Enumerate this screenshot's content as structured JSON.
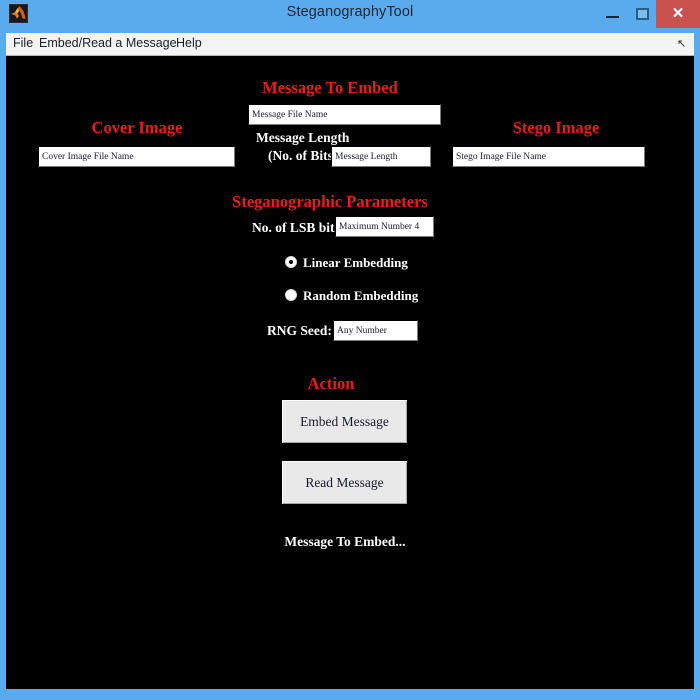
{
  "window": {
    "title": "SteganographyTool",
    "app_icon": "matlab-icon",
    "controls": {
      "minimize": "–",
      "maximize": "□",
      "close": "✕"
    },
    "frame_color": "#5aabee",
    "close_color": "#c9524f",
    "client_background": "#000000"
  },
  "menubar": {
    "items": [
      {
        "label": "File"
      },
      {
        "label": "Embed/Read a Message"
      },
      {
        "label": "Help"
      }
    ],
    "overflow_icon": "↖"
  },
  "theme": {
    "heading_color": "#f01a1a",
    "label_color": "#ffffff",
    "field_background": "#ffffff",
    "button_face": "#e9e9e9"
  },
  "panels": {
    "cover_image": {
      "heading": "Cover Image",
      "file_field": {
        "value": "",
        "placeholder": "Cover Image File Name"
      }
    },
    "message_to_embed": {
      "heading": "Message To Embed",
      "file_field": {
        "value": "",
        "placeholder": "Message File Name"
      },
      "length_label_line1": "Message Length",
      "length_label_line2": "(No. of Bits):",
      "length_field": {
        "value": "",
        "placeholder": "Message Length"
      }
    },
    "stego_image": {
      "heading": "Stego Image",
      "file_field": {
        "value": "",
        "placeholder": "Stego Image File Name"
      }
    },
    "steganographic_parameters": {
      "heading": "Steganographic Parameters",
      "lsb_label": "No. of LSB bits:",
      "lsb_field": {
        "value": "",
        "placeholder": "Maximum Number 4"
      },
      "embedding_options": [
        {
          "label": "Linear Embedding",
          "selected": true
        },
        {
          "label": "Random Embedding",
          "selected": false
        }
      ],
      "rng_seed_label": "RNG Seed:",
      "rng_seed_field": {
        "value": "",
        "placeholder": "Any Number"
      }
    },
    "action": {
      "heading": "Action",
      "embed_button": "Embed Message",
      "read_button": "Read Message",
      "status": "Message To Embed..."
    }
  }
}
